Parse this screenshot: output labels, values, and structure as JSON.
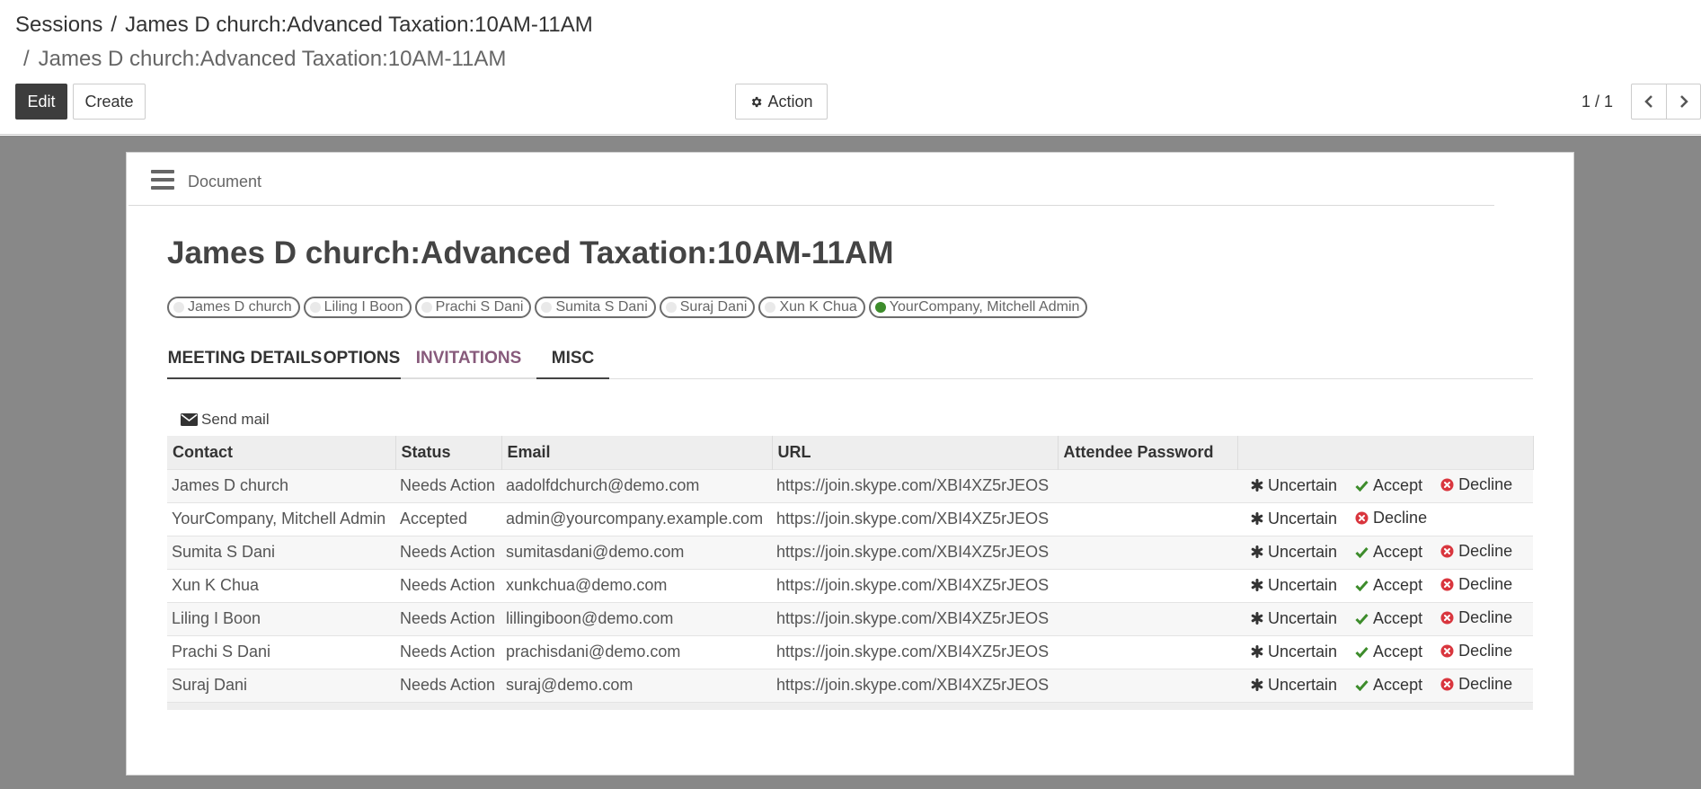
{
  "breadcrumb": {
    "parent": "Sessions",
    "current": "James D church:Advanced Taxation:10AM-11AM",
    "sub_current": "James D church:Advanced Taxation:10AM-11AM",
    "separator": "/"
  },
  "toolbar": {
    "edit_label": "Edit",
    "create_label": "Create",
    "action_label": "Action",
    "action_icon": "gear-icon"
  },
  "pager": {
    "value": "1 / 1",
    "prev_icon": "chevron-left-icon",
    "next_icon": "chevron-right-icon"
  },
  "document_header": {
    "menu_icon": "hamburger-icon",
    "label": "Document"
  },
  "record": {
    "title": "James D church:Advanced Taxation:10AM-11AM"
  },
  "attendees": [
    {
      "name": "James D church",
      "status": "needsAction"
    },
    {
      "name": "Liling I Boon",
      "status": "needsAction"
    },
    {
      "name": "Prachi S Dani",
      "status": "needsAction"
    },
    {
      "name": "Sumita S Dani",
      "status": "needsAction"
    },
    {
      "name": "Suraj Dani",
      "status": "needsAction"
    },
    {
      "name": "Xun K Chua",
      "status": "needsAction"
    },
    {
      "name": "YourCompany, Mitchell Admin",
      "status": "accepted"
    }
  ],
  "tabs": [
    {
      "label": "MEETING DETAILS",
      "active": false
    },
    {
      "label": "OPTIONS",
      "active": false
    },
    {
      "label": "INVITATIONS",
      "active": true
    },
    {
      "label": "MISC",
      "active": false
    }
  ],
  "invitations": {
    "send_mail_label": "Send mail",
    "send_mail_icon": "envelope-icon",
    "columns": [
      "Contact",
      "Status",
      "Email",
      "URL",
      "Attendee Password",
      ""
    ],
    "action_labels": {
      "uncertain": "Uncertain",
      "accept": "Accept",
      "decline": "Decline"
    },
    "rows": [
      {
        "contact": "James D church",
        "status": "Needs Action",
        "email": "aadolfdchurch@demo.com",
        "url": "https://join.skype.com/XBI4XZ5rJEOS",
        "password": "",
        "actions": [
          "uncertain",
          "accept",
          "decline"
        ]
      },
      {
        "contact": "YourCompany, Mitchell Admin",
        "status": "Accepted",
        "email": "admin@yourcompany.example.com",
        "url": "https://join.skype.com/XBI4XZ5rJEOS",
        "password": "",
        "actions": [
          "uncertain",
          "decline"
        ]
      },
      {
        "contact": "Sumita S Dani",
        "status": "Needs Action",
        "email": "sumitasdani@demo.com",
        "url": "https://join.skype.com/XBI4XZ5rJEOS",
        "password": "",
        "actions": [
          "uncertain",
          "accept",
          "decline"
        ]
      },
      {
        "contact": "Xun K Chua",
        "status": "Needs Action",
        "email": "xunkchua@demo.com",
        "url": "https://join.skype.com/XBI4XZ5rJEOS",
        "password": "",
        "actions": [
          "uncertain",
          "accept",
          "decline"
        ]
      },
      {
        "contact": "Liling I Boon",
        "status": "Needs Action",
        "email": "lillingiboon@demo.com",
        "url": "https://join.skype.com/XBI4XZ5rJEOS",
        "password": "",
        "actions": [
          "uncertain",
          "accept",
          "decline"
        ]
      },
      {
        "contact": "Prachi S Dani",
        "status": "Needs Action",
        "email": "prachisdani@demo.com",
        "url": "https://join.skype.com/XBI4XZ5rJEOS",
        "password": "",
        "actions": [
          "uncertain",
          "accept",
          "decline"
        ]
      },
      {
        "contact": "Suraj Dani",
        "status": "Needs Action",
        "email": "suraj@demo.com",
        "url": "https://join.skype.com/XBI4XZ5rJEOS",
        "password": "",
        "actions": [
          "uncertain",
          "accept",
          "decline"
        ]
      }
    ]
  },
  "colors": {
    "accent": "#875a7b",
    "accepted_dot": "#3d8c2b",
    "accept_check": "#3d8c2b",
    "decline_x": "#d9363e",
    "backdrop": "#888888",
    "edit_button": "#3d3d3d"
  }
}
